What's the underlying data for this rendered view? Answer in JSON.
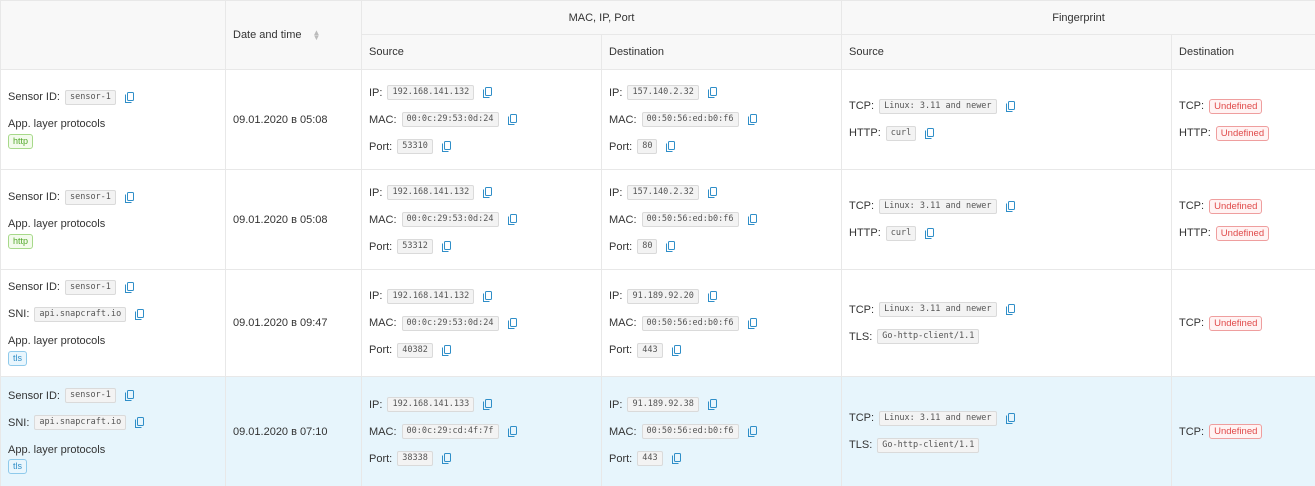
{
  "header": {
    "date_col": "Date and time",
    "mac_group": "MAC, IP, Port",
    "fp_group": "Fingerprint",
    "mac_source": "Source",
    "mac_destination": "Destination",
    "fp_source": "Source",
    "fp_destination": "Destination"
  },
  "labels": {
    "sensor_id": "Sensor ID:",
    "sni": "SNI:",
    "app_protocols": "App. layer protocols",
    "ip": "IP:",
    "mac": "MAC:",
    "port": "Port:",
    "tcp": "TCP:",
    "http": "HTTP:",
    "tls": "TLS:"
  },
  "rows": [
    {
      "sensor": "sensor-1",
      "sni": null,
      "protocol": "http",
      "date": "09.01.2020 в 05:08",
      "src": {
        "ip": "192.168.141.132",
        "mac": "00:0c:29:53:0d:24",
        "port": "53310"
      },
      "dst": {
        "ip": "157.140.2.32",
        "mac": "00:50:56:ed:b0:f6",
        "port": "80"
      },
      "fp_src": {
        "tcp": "Linux: 3.11 and newer",
        "second_label": "HTTP:",
        "second": "curl"
      },
      "fp_dst": {
        "tcp": "Undefined",
        "http": "Undefined"
      }
    },
    {
      "sensor": "sensor-1",
      "sni": null,
      "protocol": "http",
      "date": "09.01.2020 в 05:08",
      "src": {
        "ip": "192.168.141.132",
        "mac": "00:0c:29:53:0d:24",
        "port": "53312"
      },
      "dst": {
        "ip": "157.140.2.32",
        "mac": "00:50:56:ed:b0:f6",
        "port": "80"
      },
      "fp_src": {
        "tcp": "Linux: 3.11 and newer",
        "second_label": "HTTP:",
        "second": "curl"
      },
      "fp_dst": {
        "tcp": "Undefined",
        "http": "Undefined"
      }
    },
    {
      "sensor": "sensor-1",
      "sni": "api.snapcraft.io",
      "protocol": "tls",
      "date": "09.01.2020 в 09:47",
      "src": {
        "ip": "192.168.141.132",
        "mac": "00:0c:29:53:0d:24",
        "port": "40382"
      },
      "dst": {
        "ip": "91.189.92.20",
        "mac": "00:50:56:ed:b0:f6",
        "port": "443"
      },
      "fp_src": {
        "tcp": "Linux: 3.11 and newer",
        "second_label": "TLS:",
        "second": "Go-http-client/1.1"
      },
      "fp_dst": {
        "tcp": "Undefined",
        "http": null
      }
    },
    {
      "sensor": "sensor-1",
      "sni": "api.snapcraft.io",
      "protocol": "tls",
      "date": "09.01.2020 в 07:10",
      "src": {
        "ip": "192.168.141.133",
        "mac": "00:0c:29:cd:4f:7f",
        "port": "38338"
      },
      "dst": {
        "ip": "91.189.92.38",
        "mac": "00:50:56:ed:b0:f6",
        "port": "443"
      },
      "fp_src": {
        "tcp": "Linux: 3.11 and newer",
        "second_label": "TLS:",
        "second": "Go-http-client/1.1"
      },
      "fp_dst": {
        "tcp": "Undefined",
        "http": null
      }
    }
  ],
  "colors": {
    "copy_icon": "#2f8ec8",
    "undefined_badge": "#e04a4a",
    "selected_row": "#e7f5fc",
    "header_bg": "#f8f8f8"
  },
  "icons": {
    "copy": "copy-icon",
    "sort": "sort-icon"
  }
}
